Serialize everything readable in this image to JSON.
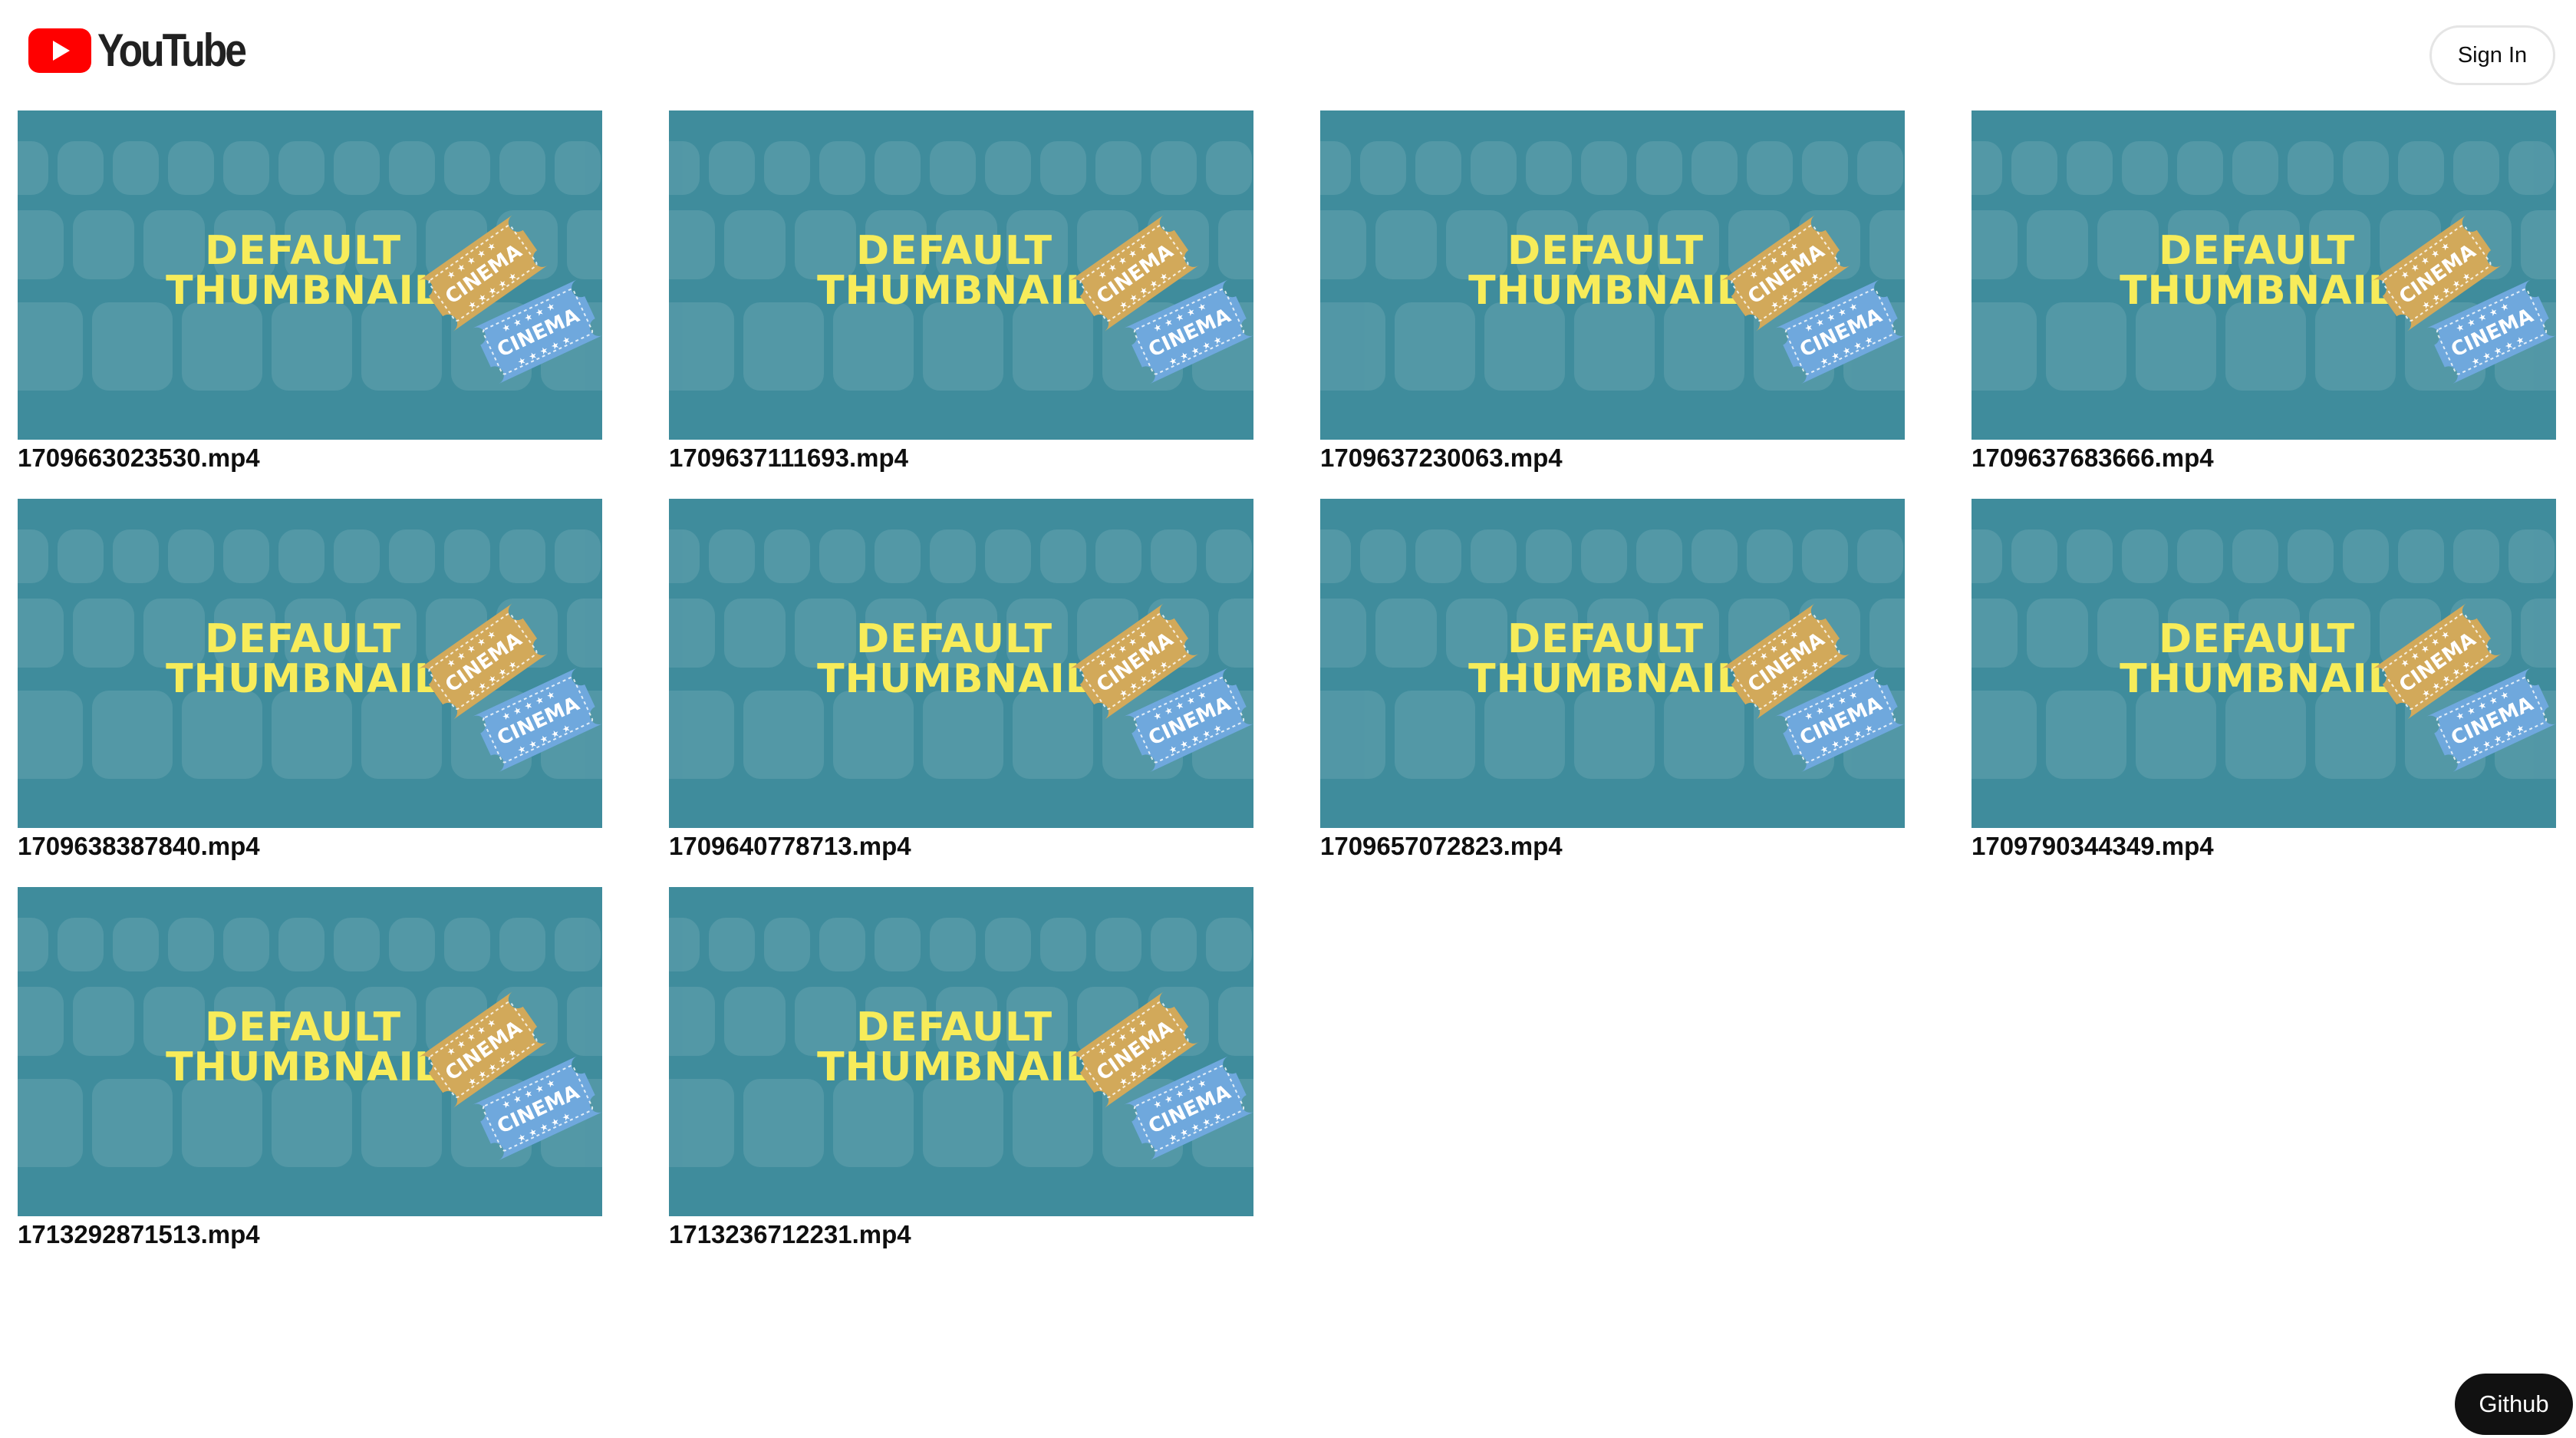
{
  "header": {
    "logo_text": "YouTube",
    "sign_in_label": "Sign In"
  },
  "thumbnail": {
    "line1": "DEFAULT",
    "line2": "THUMBNAIL",
    "ticket_label": "CINEMA",
    "background_color": "#3f8c9c",
    "text_color": "#f7ec5a",
    "ticket_gold": "#d2a95a",
    "ticket_blue": "#6fa8dd"
  },
  "videos": [
    {
      "title": "1709663023530.mp4"
    },
    {
      "title": "1709637111693.mp4"
    },
    {
      "title": "1709637230063.mp4"
    },
    {
      "title": "1709637683666.mp4"
    },
    {
      "title": "1709638387840.mp4"
    },
    {
      "title": "1709640778713.mp4"
    },
    {
      "title": "1709657072823.mp4"
    },
    {
      "title": "1709790344349.mp4"
    },
    {
      "title": "1713292871513.mp4"
    },
    {
      "title": "1713236712231.mp4"
    }
  ],
  "footer": {
    "github_label": "Github"
  },
  "colors": {
    "brand_red": "#ff0000",
    "text_dark": "#0f0f0f"
  }
}
